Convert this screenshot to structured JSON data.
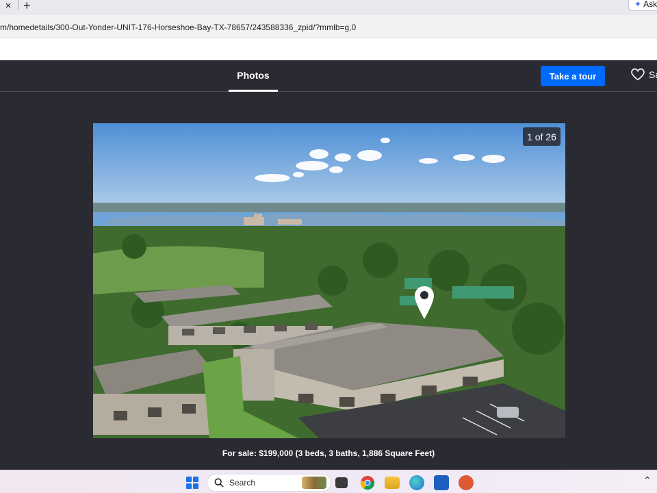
{
  "browser": {
    "tab_close": "×",
    "new_tab": "+",
    "ask_label": "Ask",
    "url": "m/homedetails/300-Out-Yonder-UNIT-176-Horseshoe-Bay-TX-78657/243588336_zpid/?mmlb=g,0"
  },
  "nav": {
    "photos_tab": "Photos",
    "tour_button": "Take a tour",
    "save_label": "Sa"
  },
  "gallery": {
    "counter": "1 of 26"
  },
  "listing": {
    "caption": "For sale: $199,000 (3 beds, 3 baths, 1,886 Square Feet)"
  },
  "taskbar": {
    "search_placeholder": "Search"
  },
  "colors": {
    "nav_bg": "#2a2a33",
    "accent": "#006aff"
  }
}
